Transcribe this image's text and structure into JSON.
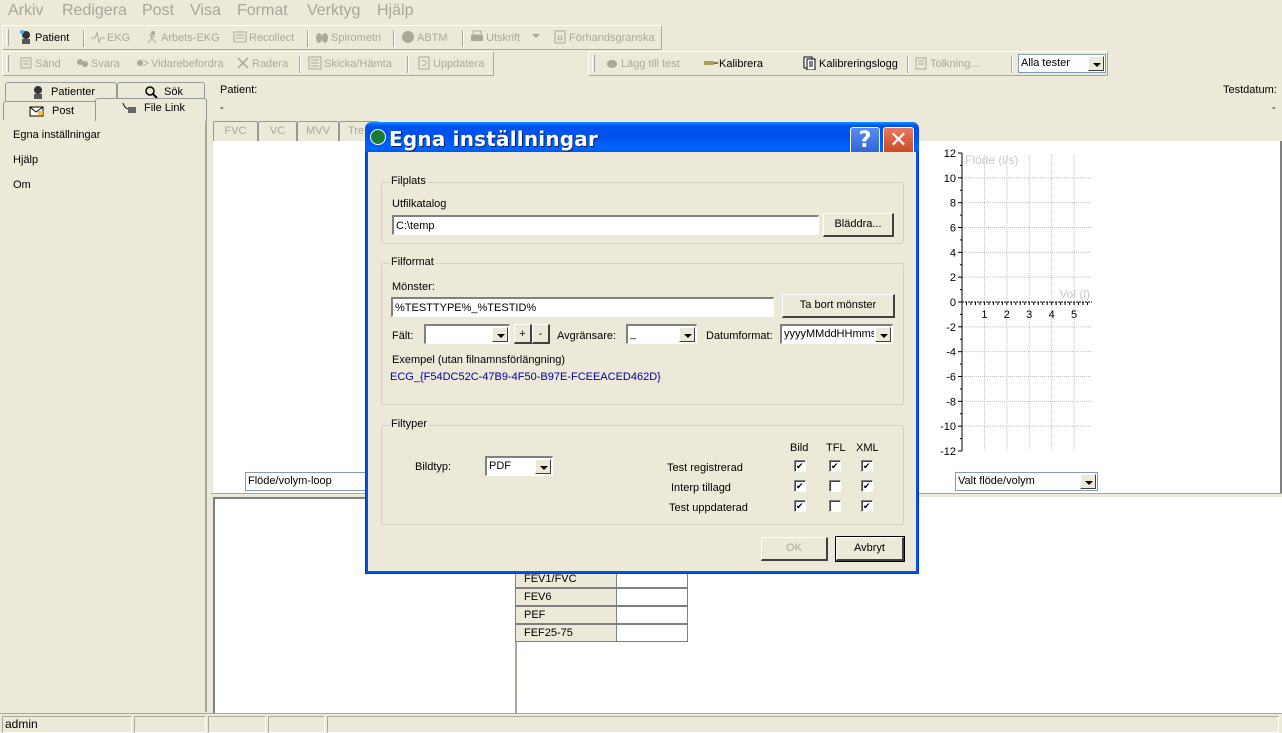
{
  "menu": [
    "Arkiv",
    "Redigera",
    "Post",
    "Visa",
    "Format",
    "Verktyg",
    "Hjälp"
  ],
  "toolbar1": {
    "patient": "Patient",
    "ekg": "EKG",
    "arbets_ekg": "Arbets-EKG",
    "recollect": "Recollect",
    "spirometri": "Spirometri",
    "abtm": "ABTM",
    "utskrift": "Utskrift",
    "forhandsgranska": "Förhandsgranska"
  },
  "toolbar2": {
    "sand": "Sänd",
    "svara": "Svara",
    "vidarebefordra": "Vidarebefordra",
    "radera": "Radera",
    "skicka_hamta": "Skicka/Hämta",
    "uppdatera": "Uppdatera"
  },
  "toolbar3": {
    "lagg_till_test": "Lägg till test",
    "kalibrera": "Kalibrera",
    "kalibreringslogg": "Kalibreringslogg",
    "tolkning": "Tolkning...",
    "filter_value": "Alla tester"
  },
  "left_tabs": {
    "patienter": "Patienter",
    "sok": "Sök",
    "post": "Post",
    "file_link": "File Link"
  },
  "sidebar": {
    "items": [
      "Egna inställningar",
      "Hjälp",
      "Om"
    ]
  },
  "patient_header": {
    "patient_label": "Patient:",
    "patient_value": "-",
    "testdatum_label": "Testdatum:",
    "testdatum_value": "-"
  },
  "test_tabs": [
    "FVC",
    "VC",
    "MVV",
    "Tre"
  ],
  "left_graph_select": "Flöde/volym-loop",
  "right_graph_select": "Valt flöde/volym",
  "results_table": [
    {
      "key": "FEV1/FVC",
      "value": ""
    },
    {
      "key": "FEV6",
      "value": ""
    },
    {
      "key": "PEF",
      "value": ""
    },
    {
      "key": "FEF25-75",
      "value": ""
    }
  ],
  "statusbar": {
    "user": "admin"
  },
  "dialog": {
    "title": "Egna inställningar",
    "help_btn": "?",
    "close_btn": "✕",
    "filplats": {
      "legend": "Filplats",
      "label": "Utfilkatalog",
      "value": "C:\\temp",
      "browse": "Bläddra..."
    },
    "filformat": {
      "legend": "Filformat",
      "monster_label": "Mönster:",
      "monster_value": "%TESTTYPE%_%TESTID%",
      "remove_pattern": "Ta bort mönster",
      "falt_label": "Fält:",
      "falt_value": "",
      "plus": "+",
      "minus": "-",
      "avgransare_label": "Avgränsare:",
      "avgransare_value": "_",
      "datumformat_label": "Datumformat:",
      "datumformat_value": "yyyyMMddHHmms",
      "example_label": "Exempel (utan filnamnsförlängning)",
      "example_value": "ECG_{F54DC52C-47B9-4F50-B97E-FCEEACED462D}",
      "example_color": "#0000a0"
    },
    "filtyper": {
      "legend": "Filtyper",
      "bildtyp_label": "Bildtyp:",
      "bildtyp_value": "PDF",
      "columns": [
        "Bild",
        "TFL",
        "XML"
      ],
      "rows": [
        {
          "label": "Test registrerad",
          "bild": true,
          "tfl": true,
          "xml": true
        },
        {
          "label": "Interp tillagd",
          "bild": true,
          "tfl": false,
          "xml": true
        },
        {
          "label": "Test uppdaterad",
          "bild": true,
          "tfl": false,
          "xml": true
        }
      ]
    },
    "ok": "OK",
    "cancel": "Avbryt"
  },
  "chart_data": {
    "type": "line",
    "title": "",
    "xlabel": "Vol (l)",
    "ylabel": "Flöde (l/s)",
    "xlim": [
      0,
      5.8
    ],
    "ylim": [
      -12,
      12
    ],
    "xticks": [
      1,
      2,
      3,
      4,
      5
    ],
    "yticks": [
      12,
      10,
      8,
      6,
      4,
      2,
      0,
      -2,
      -4,
      -6,
      -8,
      -10,
      -12
    ],
    "grid": true,
    "series": []
  }
}
